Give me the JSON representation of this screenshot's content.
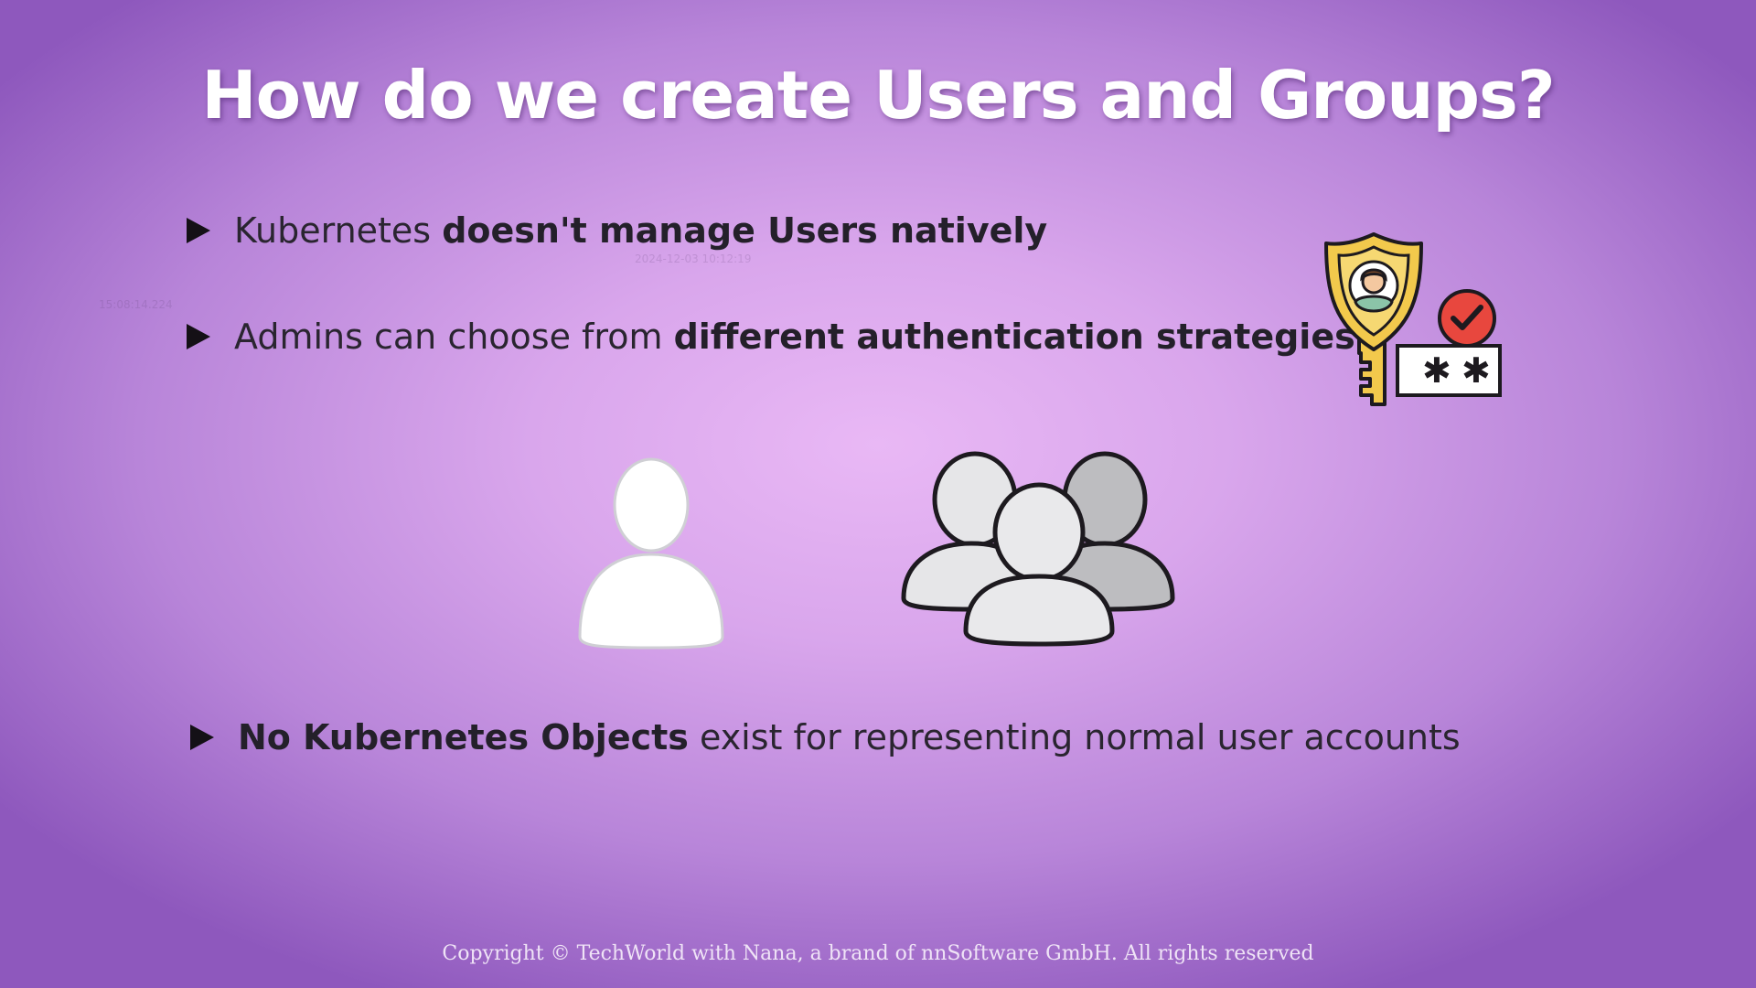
{
  "slide": {
    "title": "How do we create Users and Groups?",
    "bullets": [
      {
        "normal_before": "Kubernetes ",
        "bold": "doesn't manage Users natively",
        "normal_after": ""
      },
      {
        "normal_before": "Admins can choose from ",
        "bold": "different authentication strategies",
        "normal_after": ""
      },
      {
        "normal_before": "",
        "bold": "No Kubernetes Objects",
        "normal_after": " exist for representing normal user accounts"
      }
    ],
    "ghost_timestamps": [
      "2024-12-03 10:12:19",
      "15:08:14.224"
    ],
    "copyright": "Copyright © TechWorld with Nana, a brand of nnSoftware GmbH. All rights reserved"
  },
  "icons": {
    "auth": "security-key-icon",
    "user": "user-icon",
    "group": "user-group-icon"
  },
  "colors": {
    "background_center": "#e9b8f5",
    "background_edge": "#8e58bd",
    "title": "#ffffff",
    "text": "#2a2530",
    "shield_gold": "#f2c94c",
    "check_red": "#e8473e"
  }
}
